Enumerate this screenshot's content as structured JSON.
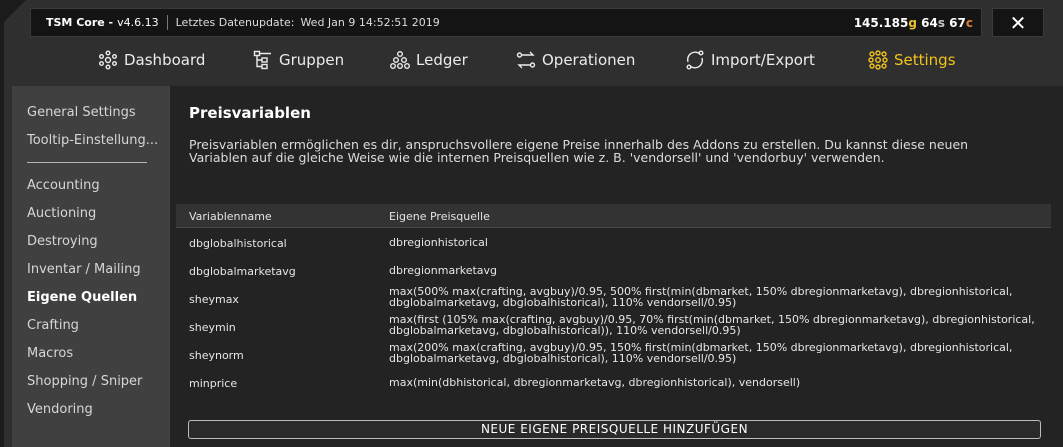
{
  "titlebar": {
    "app_name": "TSM Core -",
    "version": "v4.6.13",
    "update_label": "Letztes Datenupdate:",
    "update_date": "Wed Jan  9 14:52:51 2019",
    "gold": {
      "g_value": "145.185",
      "g_unit": "g",
      "s_value": "64",
      "s_unit": "s",
      "c_value": "67",
      "c_unit": "c"
    },
    "close_label": "✕"
  },
  "nav": [
    {
      "label": "Dashboard",
      "icon": "dashboard-icon"
    },
    {
      "label": "Gruppen",
      "icon": "groups-icon"
    },
    {
      "label": "Ledger",
      "icon": "ledger-icon"
    },
    {
      "label": "Operationen",
      "icon": "operations-icon"
    },
    {
      "label": "Import/Export",
      "icon": "import-export-icon"
    },
    {
      "label": "Settings",
      "icon": "settings-icon",
      "active": true
    }
  ],
  "sidebar": {
    "items": [
      "General Settings",
      "Tooltip-Einstellung...",
      "Accounting",
      "Auctioning",
      "Destroying",
      "Inventar / Mailing",
      "Eigene Quellen",
      "Crafting",
      "Macros",
      "Shopping / Sniper",
      "Vendoring"
    ],
    "active": "Eigene Quellen"
  },
  "content": {
    "title": "Preisvariablen",
    "description": "Preisvariablen ermöglichen es dir, anspruchsvollere eigene Preise innerhalb des Addons zu erstellen. Du kannst diese neuen Variablen auf die gleiche Weise wie die internen Preisquellen wie z. B. 'vendorsell' und 'vendorbuy' verwenden.",
    "table": {
      "headers": [
        "Variablenname",
        "Eigene Preisquelle"
      ],
      "rows": [
        {
          "name": "dbglobalhistorical",
          "source": "dbregionhistorical"
        },
        {
          "name": "dbglobalmarketavg",
          "source": "dbregionmarketavg"
        },
        {
          "name": "sheymax",
          "source": "max(500% max(crafting, avgbuy)/0.95, 500% first(min(dbmarket, 150% dbregionmarketavg), dbregionhistorical, dbglobalmarketavg, dbglobalhistorical), 110% vendorsell/0.95)"
        },
        {
          "name": "sheymin",
          "source": "max(first (105% max(crafting, avgbuy)/0.95, 70% first(min(dbmarket, 150% dbregionmarketavg), dbregionhistorical, dbglobalmarketavg, dbglobalhistorical)), 110% vendorsell/0.95)"
        },
        {
          "name": "sheynorm",
          "source": "max(200% max(crafting, avgbuy)/0.95, 150% first(min(dbmarket, 150% dbregionmarketavg), dbregionhistorical, dbglobalmarketavg, dbglobalhistorical), 110% vendorsell/0.95)"
        },
        {
          "name": "minprice",
          "source": "max(min(dbhistorical, dbregionmarketavg, dbregionhistorical), vendorsell)"
        }
      ]
    },
    "add_button": "NEUE EIGENE PREISQUELLE HINZUFÜGEN"
  },
  "colors": {
    "accent": "#f2c41a",
    "gold": "#e8c12a",
    "silver": "#c9c9c9",
    "copper": "#d6813c"
  }
}
